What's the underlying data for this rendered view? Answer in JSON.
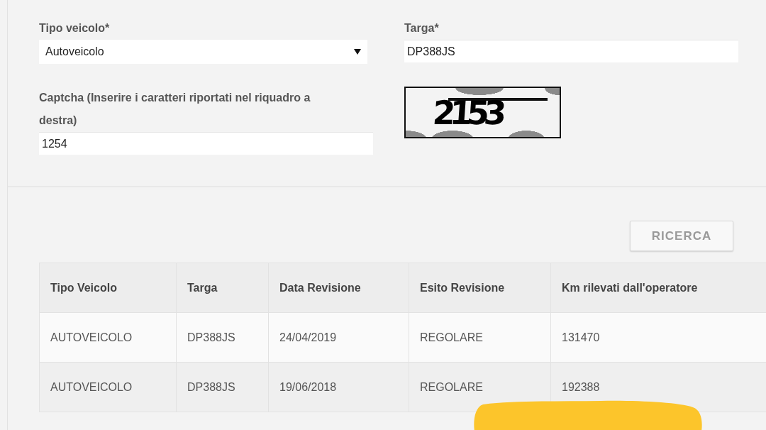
{
  "form": {
    "fields": [
      {
        "kind": "select",
        "label": "Tipo veicolo*",
        "value": "Autoveicolo"
      },
      {
        "kind": "text",
        "label": "Targa*",
        "value": "DP388JS"
      },
      {
        "kind": "text",
        "label": "Captcha (Inserire i caratteri riportati nel riquadro a destra)",
        "value": "1254"
      }
    ],
    "captcha_image": {
      "text": "2153"
    }
  },
  "search_button": {
    "label": "RICERCA"
  },
  "table": {
    "columns": [
      "Tipo Veicolo",
      "Targa",
      "Data Revisione",
      "Esito Revisione",
      "Km rilevati dall'operatore"
    ],
    "rows": [
      [
        "AUTOVEICOLO",
        "DP388JS",
        "24/04/2019",
        "REGOLARE",
        "131470"
      ],
      [
        "AUTOVEICOLO",
        "DP388JS",
        "19/06/2018",
        "REGOLARE",
        "192388"
      ]
    ]
  }
}
